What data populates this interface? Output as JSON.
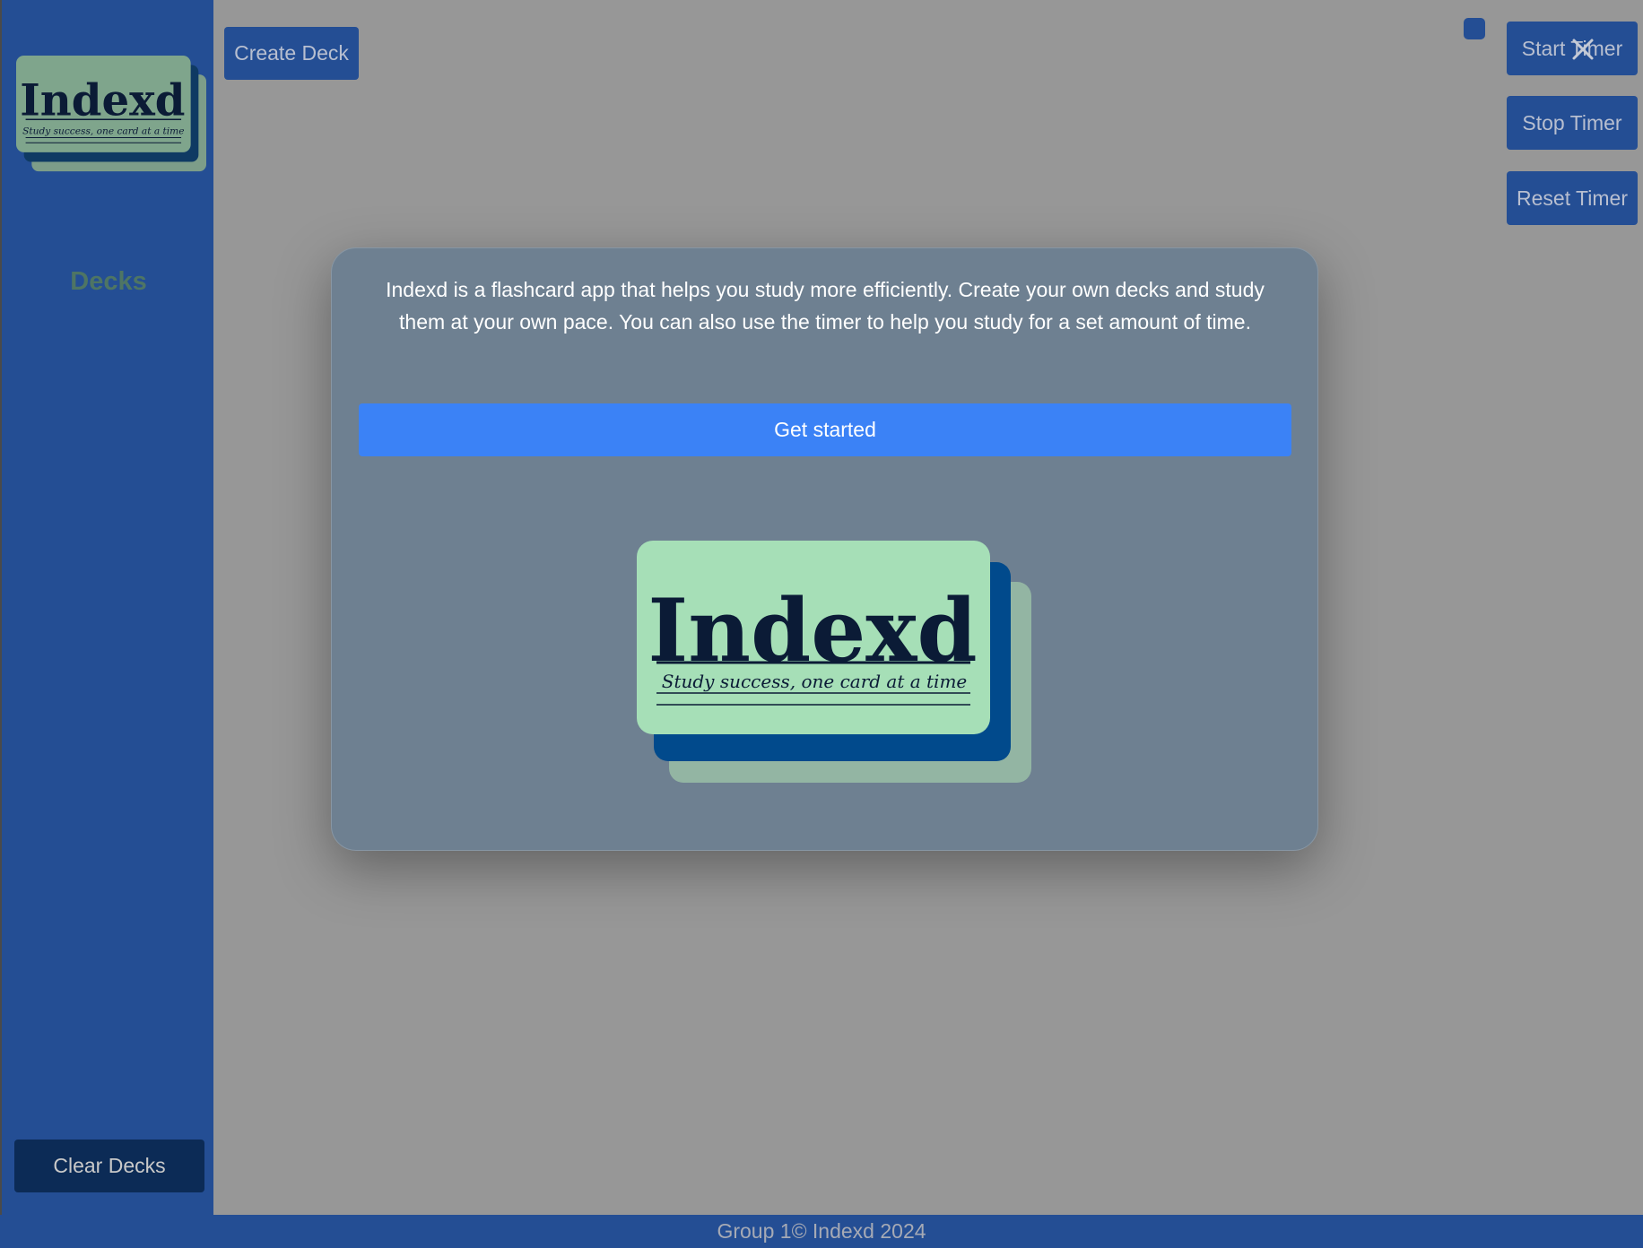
{
  "app": {
    "logo": {
      "wordmark": "Indexd",
      "tagline": "Study success, one card at a time"
    }
  },
  "sidebar": {
    "title": "Decks",
    "clear_button": "Clear Decks"
  },
  "toolbar": {
    "create_deck_button": "Create Deck"
  },
  "timer": {
    "start_button": "Start Timer",
    "stop_button": "Stop Timer",
    "reset_button": "Reset Timer"
  },
  "modal": {
    "description": "Indexd is a flashcard app that helps you study more efficiently. Create your own decks and study them at your own pace. You can also use the timer to help you study for a set amount of time.",
    "cta_button": "Get started",
    "close_icon": "close-icon"
  },
  "footer": {
    "text": "Group 1© Indexd 2024"
  },
  "colors": {
    "overlay_background": "#979797",
    "sidebar": "#244e94",
    "modal": "#6e8091",
    "primary_button": "#3b82f6",
    "card_green": "#a6dfb7",
    "card_blue": "#014a8c",
    "card_sage": "#93b5a3",
    "wordmark": "#0b1b36"
  }
}
